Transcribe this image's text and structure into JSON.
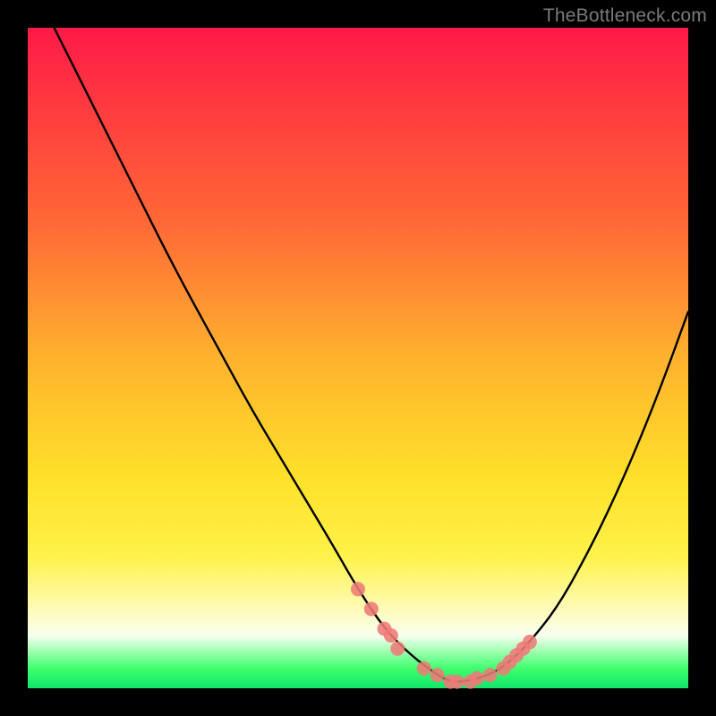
{
  "watermark": "TheBottleneck.com",
  "colors": {
    "background": "#000000",
    "curve_stroke": "#000000",
    "marker_fill": "#ee7a78",
    "gradient_top": "#ff1a48",
    "gradient_bottom": "#10e66a"
  },
  "chart_data": {
    "type": "line",
    "title": "",
    "xlabel": "",
    "ylabel": "",
    "xlim": [
      0,
      100
    ],
    "ylim": [
      0,
      100
    ],
    "grid": false,
    "legend": false,
    "series": [
      {
        "name": "bottleneck-curve",
        "x": [
          4,
          10,
          16,
          22,
          28,
          34,
          40,
          46,
          50,
          54,
          58,
          62,
          64,
          66,
          70,
          73,
          76,
          80,
          84,
          88,
          92,
          96,
          100
        ],
        "y": [
          100,
          88,
          76,
          64,
          53,
          42,
          32,
          22,
          15,
          9,
          5,
          2,
          1,
          1,
          2,
          4,
          7,
          12,
          19,
          27,
          36,
          46,
          57
        ]
      }
    ],
    "markers": {
      "name": "highlighted-points",
      "x": [
        50,
        52,
        54,
        55,
        56,
        60,
        62,
        64,
        65,
        67,
        68,
        70,
        72,
        73,
        74,
        75,
        76
      ],
      "y": [
        15,
        12,
        9,
        8,
        6,
        3,
        2,
        1,
        1,
        1,
        1.5,
        2,
        3,
        4,
        5,
        6,
        7
      ]
    }
  }
}
